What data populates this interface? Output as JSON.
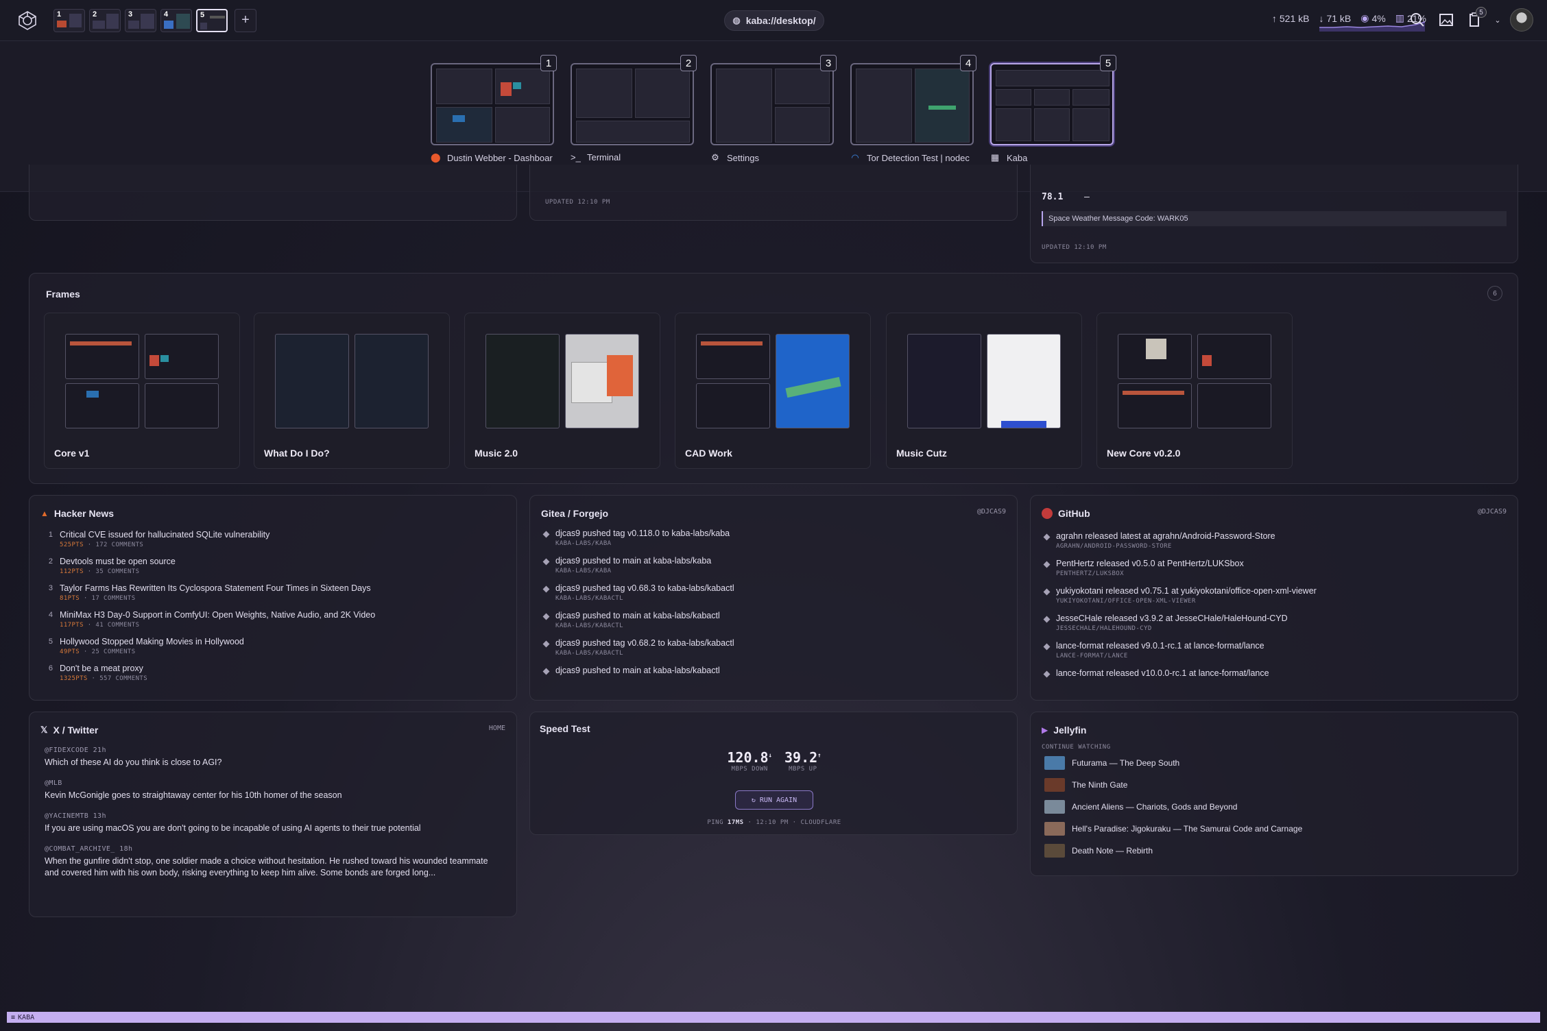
{
  "topbar": {
    "workspaces": [
      "1",
      "2",
      "3",
      "4",
      "5"
    ],
    "add_label": "+",
    "url": "kaba://desktop/",
    "net_up": "521 kB",
    "net_down": "71 kB",
    "cpu": "4%",
    "mem": "21%",
    "notif_count": "5"
  },
  "overview": {
    "items": [
      {
        "num": "1",
        "label": "Dustin Webber - Dashboar",
        "icon": "firefox-icon"
      },
      {
        "num": "2",
        "label": "Terminal",
        "icon": "terminal-icon"
      },
      {
        "num": "3",
        "label": "Settings",
        "icon": "gear-icon"
      },
      {
        "num": "4",
        "label": "Tor Detection Test | nodec",
        "icon": "wifi-icon"
      },
      {
        "num": "5",
        "label": "Kaba",
        "icon": "grid-icon"
      }
    ]
  },
  "partial": {
    "updated_mid": "UPDATED 12:10 PM",
    "weather_value": "78.1",
    "weather_dash": "–",
    "weather_msg": "Space Weather Message Code: WARK05",
    "updated_right": "UPDATED 12:10 PM"
  },
  "frames": {
    "title": "Frames",
    "count": "6",
    "items": [
      "Core v1",
      "What Do I Do?",
      "Music 2.0",
      "CAD Work",
      "Music Cutz",
      "New Core v0.2.0"
    ]
  },
  "hackernews": {
    "title": "Hacker News",
    "items": [
      {
        "n": "1",
        "title": "Critical CVE issued for hallucinated SQLite vulnerability",
        "pts": "525PTS",
        "comments": "172 COMMENTS"
      },
      {
        "n": "2",
        "title": "Devtools must be open source",
        "pts": "112PTS",
        "comments": "35 COMMENTS"
      },
      {
        "n": "3",
        "title": "Taylor Farms Has Rewritten Its Cyclospora Statement Four Times in Sixteen Days",
        "pts": "81PTS",
        "comments": "17 COMMENTS"
      },
      {
        "n": "4",
        "title": "MiniMax H3 Day-0 Support in ComfyUI: Open Weights, Native Audio, and 2K Video",
        "pts": "117PTS",
        "comments": "41 COMMENTS"
      },
      {
        "n": "5",
        "title": "Hollywood Stopped Making Movies in Hollywood",
        "pts": "49PTS",
        "comments": "25 COMMENTS"
      },
      {
        "n": "6",
        "title": "Don't be a meat proxy",
        "pts": "1325PTS",
        "comments": "557 COMMENTS"
      }
    ]
  },
  "gitea": {
    "title": "Gitea / Forgejo",
    "user": "@DJCAS9",
    "items": [
      {
        "title": "djcas9 pushed tag v0.118.0 to kaba-labs/kaba",
        "repo": "KABA-LABS/KABA"
      },
      {
        "title": "djcas9 pushed to main at kaba-labs/kaba",
        "repo": "KABA-LABS/KABA"
      },
      {
        "title": "djcas9 pushed tag v0.68.3 to kaba-labs/kabactl",
        "repo": "KABA-LABS/KABACTL"
      },
      {
        "title": "djcas9 pushed to main at kaba-labs/kabactl",
        "repo": "KABA-LABS/KABACTL"
      },
      {
        "title": "djcas9 pushed tag v0.68.2 to kaba-labs/kabactl",
        "repo": "KABA-LABS/KABACTL"
      },
      {
        "title": "djcas9 pushed to main at kaba-labs/kabactl",
        "repo": ""
      }
    ]
  },
  "github": {
    "title": "GitHub",
    "user": "@DJCAS9",
    "items": [
      {
        "title": "agrahn released latest at agrahn/Android-Password-Store",
        "repo": "AGRAHN/ANDROID-PASSWORD-STORE"
      },
      {
        "title": "PentHertz released v0.5.0 at PentHertz/LUKSbox",
        "repo": "PENTHERTZ/LUKSBOX"
      },
      {
        "title": "yukiyokotani released v0.75.1 at yukiyokotani/office-open-xml-viewer",
        "repo": "YUKIYOKOTANI/OFFICE-OPEN-XML-VIEWER"
      },
      {
        "title": "JesseCHale released v3.9.2 at JesseCHale/HaleHound-CYD",
        "repo": "JESSECHALE/HALEHOUND-CYD"
      },
      {
        "title": "lance-format released v9.0.1-rc.1 at lance-format/lance",
        "repo": "LANCE-FORMAT/LANCE"
      },
      {
        "title": "lance-format released v10.0.0-rc.1 at lance-format/lance",
        "repo": ""
      }
    ]
  },
  "twitter": {
    "title": "X / Twitter",
    "scope": "HOME",
    "items": [
      {
        "handle": "@FIDEXCODE",
        "time": "21h",
        "text": "Which of these AI do you think is close to AGI?"
      },
      {
        "handle": "@MLB",
        "time": "",
        "text": "Kevin McGonigle goes to straightaway center for his 10th homer of the season"
      },
      {
        "handle": "@YACINEMTB",
        "time": "13h",
        "text": "If you are using macOS you are don't going to be incapable of using AI agents to their true potential"
      },
      {
        "handle": "@COMBAT_ARCHIVE_",
        "time": "18h",
        "text": "When the gunfire didn't stop, one soldier made a choice without hesitation. He rushed toward his wounded teammate and covered him with his own body, risking everything to keep him alive. Some bonds are forged long..."
      }
    ]
  },
  "speedtest": {
    "title": "Speed Test",
    "down": "120.8",
    "down_unit": "MBPS DOWN",
    "up": "39.2",
    "up_unit": "MBPS UP",
    "button": "↻ RUN AGAIN",
    "ping_label": "PING",
    "ping": "17MS",
    "time": "12:10 PM",
    "provider": "CLOUDFLARE"
  },
  "jellyfin": {
    "title": "Jellyfin",
    "section": "CONTINUE WATCHING",
    "items": [
      "Futurama — The Deep South",
      "The Ninth Gate",
      "Ancient Aliens — Chariots, Gods and Beyond",
      "Hell's Paradise: Jigokuraku — The Samurai Code and Carnage",
      "Death Note — Rebirth"
    ]
  },
  "statusbar": {
    "label": "KABA"
  }
}
